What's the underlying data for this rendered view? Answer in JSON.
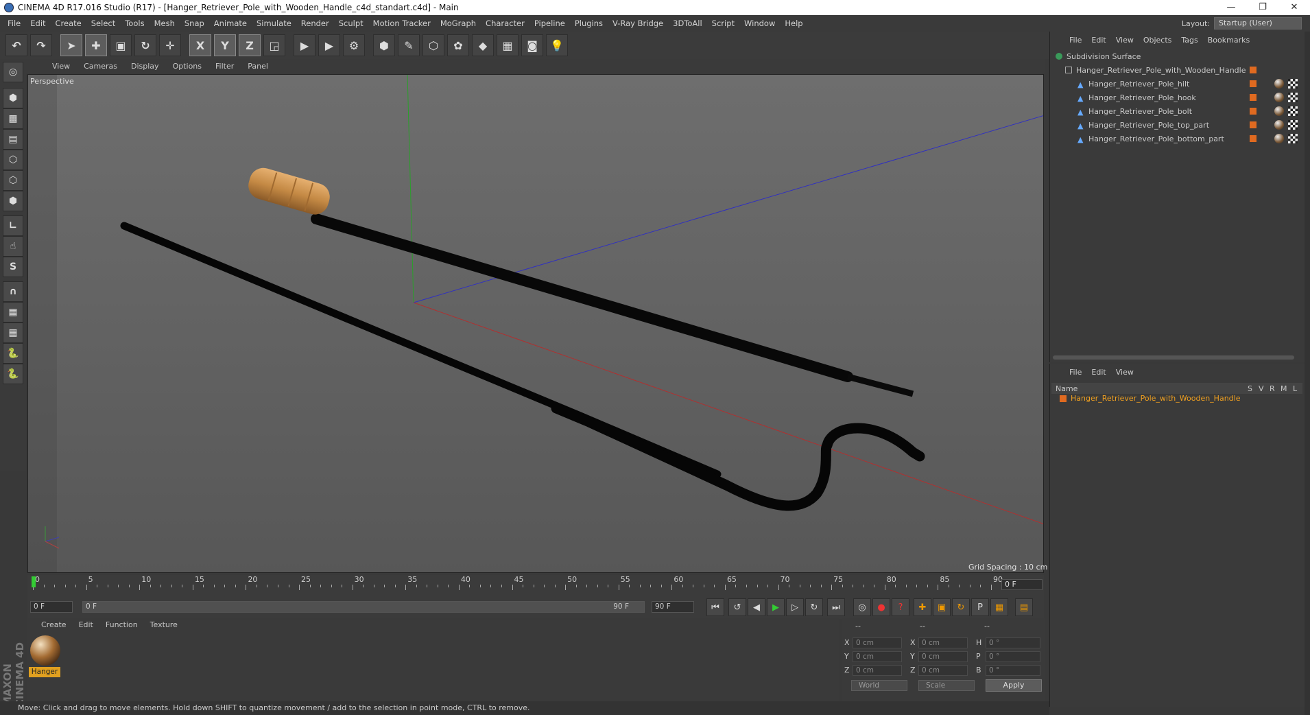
{
  "window": {
    "title": "CINEMA 4D R17.016 Studio (R17) - [Hanger_Retriever_Pole_with_Wooden_Handle_c4d_standart.c4d] - Main",
    "controls": [
      "—",
      "❐",
      "✕"
    ]
  },
  "menu": [
    "File",
    "Edit",
    "Create",
    "Select",
    "Tools",
    "Mesh",
    "Snap",
    "Animate",
    "Simulate",
    "Render",
    "Sculpt",
    "Motion Tracker",
    "MoGraph",
    "Character",
    "Pipeline",
    "Plugins",
    "V-Ray Bridge",
    "3DToAll",
    "Script",
    "Window",
    "Help"
  ],
  "layout": {
    "label": "Layout:",
    "value": "Startup (User)"
  },
  "toolbar": {
    "x": "X",
    "y": "Y",
    "z": "Z"
  },
  "viewport": {
    "menu": [
      "View",
      "Cameras",
      "Display",
      "Options",
      "Filter",
      "Panel"
    ],
    "label": "Perspective",
    "grid_spacing": "Grid Spacing : 10 cm"
  },
  "timeline": {
    "ticks": [
      "0",
      "5",
      "10",
      "15",
      "20",
      "25",
      "30",
      "35",
      "40",
      "45",
      "50",
      "55",
      "60",
      "65",
      "70",
      "75",
      "80",
      "85",
      "90"
    ],
    "current_frame": "0 F",
    "start": "0 F",
    "range_start": "0 F",
    "range_end": "90 F",
    "end": "90 F"
  },
  "material": {
    "menu": [
      "Create",
      "Edit",
      "Function",
      "Texture"
    ],
    "name": "Hanger"
  },
  "coords": {
    "dash1": "--",
    "dash2": "--",
    "dash3": "--",
    "labels": {
      "x": "X",
      "y": "Y",
      "z": "Z",
      "x2": "X",
      "y2": "Y",
      "z2": "Z",
      "h": "H",
      "p": "P",
      "b": "B"
    },
    "pos": [
      "0 cm",
      "0 cm",
      "0 cm"
    ],
    "size": [
      "0 cm",
      "0 cm",
      "0 cm"
    ],
    "rot": [
      "0 °",
      "0 °",
      "0 °"
    ],
    "space": "World",
    "mode": "Scale",
    "apply": "Apply"
  },
  "status": "Move: Click and drag to move elements. Hold down SHIFT to quantize movement / add to the selection in point mode, CTRL to remove.",
  "objects": {
    "menu": [
      "File",
      "Edit",
      "View",
      "Objects",
      "Tags",
      "Bookmarks"
    ],
    "items": [
      "Subdivision Surface",
      "Hanger_Retriever_Pole_with_Wooden_Handle",
      "Hanger_Retriever_Pole_hilt",
      "Hanger_Retriever_Pole_hook",
      "Hanger_Retriever_Pole_bolt",
      "Hanger_Retriever_Pole_top_part",
      "Hanger_Retriever_Pole_bottom_part"
    ]
  },
  "attributes": {
    "menu": [
      "File",
      "Edit",
      "View"
    ],
    "col_name": "Name",
    "cols": [
      "S",
      "V",
      "R",
      "M",
      "L"
    ],
    "item": "Hanger_Retriever_Pole_with_Wooden_Handle"
  },
  "maxon": "MAXON CINEMA 4D"
}
